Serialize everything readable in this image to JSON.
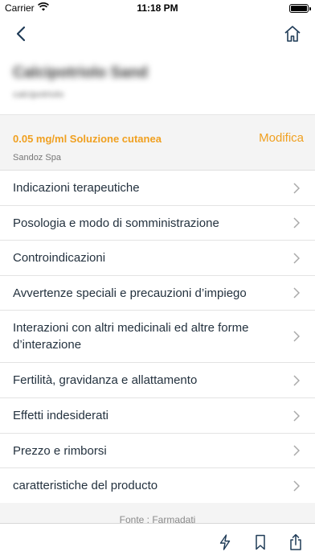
{
  "status_bar": {
    "carrier": "Carrier",
    "time": "11:18 PM",
    "icons": [
      "wifi-icon",
      "battery-icon"
    ]
  },
  "nav": {
    "back_icon": "chevron-left-icon",
    "home_icon": "home-icon"
  },
  "product": {
    "name": "Calcipotriolo Sand",
    "subtitle": "calcipotriolo"
  },
  "variant": {
    "form": "0.05 mg/ml Soluzione cutanea",
    "company": "Sandoz Spa",
    "edit_label": "Modifica"
  },
  "menu": {
    "items": [
      {
        "label": "Indicazioni terapeutiche"
      },
      {
        "label": "Posologia e modo di somministrazione"
      },
      {
        "label": "Controindicazioni"
      },
      {
        "label": "Avvertenze speciali e precauzioni d’impiego"
      },
      {
        "label": "Interazioni con altri medicinali ed altre forme d’interazione"
      },
      {
        "label": "Fertilità, gravidanza e allattamento"
      },
      {
        "label": "Effetti indesiderati"
      },
      {
        "label": "Prezzo e rimborsi"
      },
      {
        "label": "caratteristiche del producto"
      }
    ]
  },
  "footer": {
    "source": "Fonte : Farmadati"
  },
  "toolbar": {
    "icons": [
      "flash-icon",
      "bookmark-icon",
      "share-icon"
    ]
  },
  "colors": {
    "accent": "#f0a020",
    "text": "#24323f",
    "panel": "#f4f4f4",
    "divider": "#e3e3e3"
  }
}
